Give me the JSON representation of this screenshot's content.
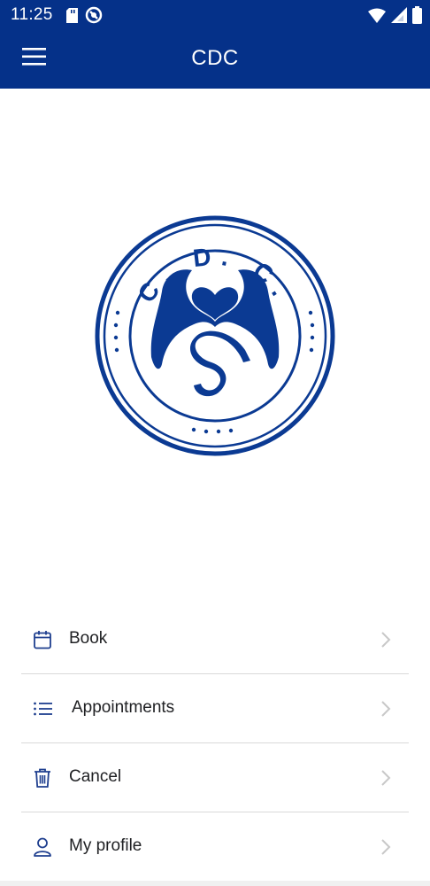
{
  "status_bar": {
    "time": "11:25",
    "icons": [
      "sd-card-icon",
      "data-saver-icon",
      "wifi-icon",
      "cell-signal-icon",
      "battery-icon"
    ]
  },
  "app_bar": {
    "title": "CDC",
    "menu_icon": "hamburger-menu-icon"
  },
  "logo": {
    "text": "C. D. C.",
    "color": "#0b3a93"
  },
  "menu": {
    "items": [
      {
        "label": "Book",
        "icon": "calendar-icon"
      },
      {
        "label": "Appointments",
        "icon": "list-icon"
      },
      {
        "label": "Cancel",
        "icon": "trash-icon"
      },
      {
        "label": "My profile",
        "icon": "user-icon"
      }
    ]
  },
  "colors": {
    "primary": "#053189",
    "icon": "#1f3f8f",
    "divider": "#d9d9d9",
    "chevron": "#c8c8c8"
  }
}
